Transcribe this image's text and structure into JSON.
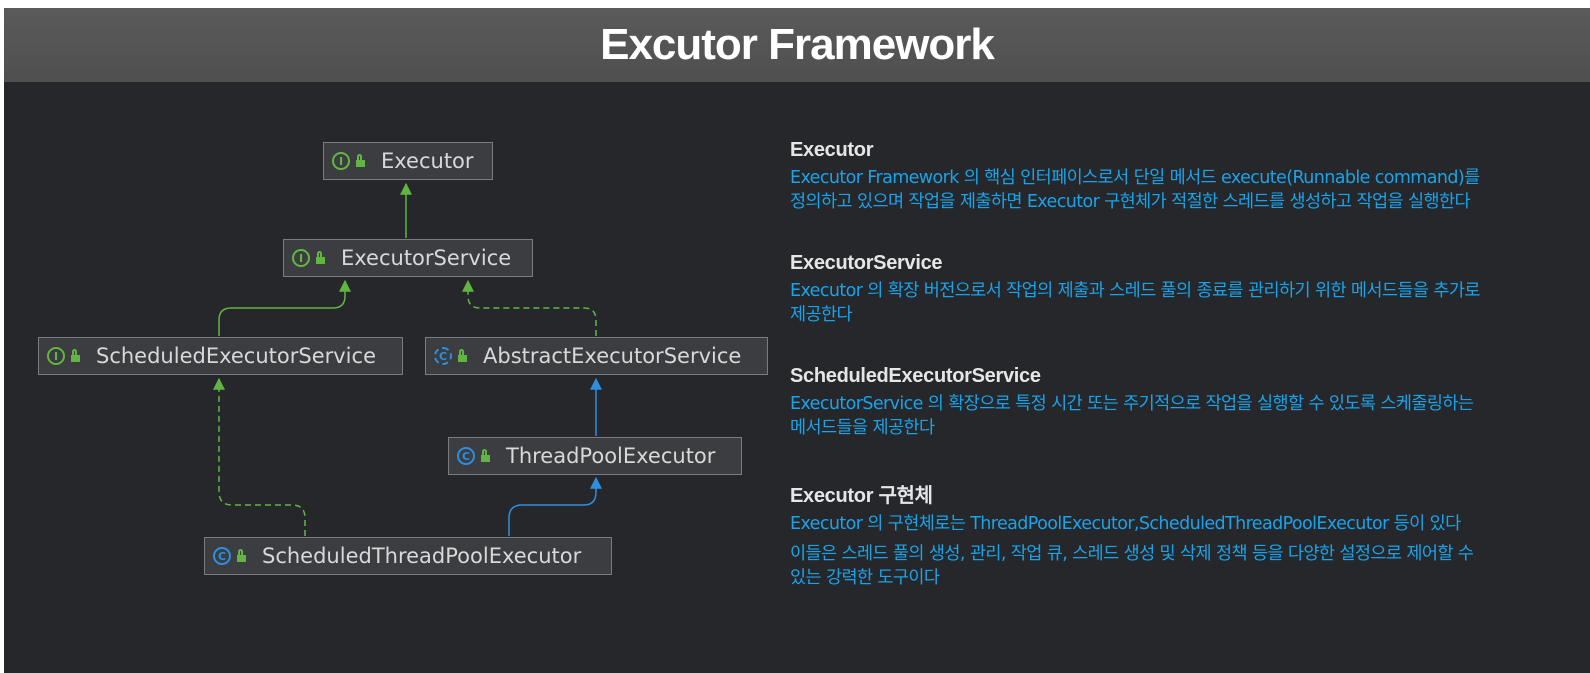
{
  "title": "Excutor Framework",
  "nodes": {
    "executor": "Executor",
    "executor_service": "ExecutorService",
    "scheduled_executor_service": "ScheduledExecutorService",
    "abstract_executor_service": "AbstractExecutorService",
    "thread_pool_executor": "ThreadPoolExecutor",
    "scheduled_thread_pool_executor": "ScheduledThreadPoolExecutor"
  },
  "kind_glyphs": {
    "interface": "I",
    "class": "C"
  },
  "colors": {
    "interface": "#62b543",
    "class": "#2e8ee0",
    "description_text": "#1aa3ea",
    "background": "#25272b",
    "header": "#555555"
  },
  "descriptions": [
    {
      "heading": "Executor",
      "lines": [
        "Executor Framework 의 핵심 인터페이스로서 단일 메서드 execute(Runnable command)를",
        "정의하고 있으며 작업을 제출하면 Executor 구현체가 적절한 스레드를 생성하고 작업을 실행한다"
      ]
    },
    {
      "heading": "ExecutorService",
      "lines": [
        "Executor 의 확장 버전으로서 작업의 제출과 스레드 풀의 종료를 관리하기 위한 메서드들을 추가로",
        "제공한다"
      ]
    },
    {
      "heading": "ScheduledExecutorService",
      "lines": [
        "ExecutorService 의 확장으로 특정 시간 또는 주기적으로 작업을 실행할 수 있도록 스케줄링하는",
        "메서드들을 제공한다"
      ]
    },
    {
      "heading": "Executor 구현체",
      "lines": [
        "Executor 의 구현체로는 ThreadPoolExecutor,ScheduledThreadPoolExecutor 등이 있다",
        "이들은 스레드 풀의 생성, 관리, 작업 큐, 스레드 생성 및 삭제 정책 등을 다양한 설정으로 제어할 수",
        "있는 강력한 도구이다"
      ]
    }
  ]
}
